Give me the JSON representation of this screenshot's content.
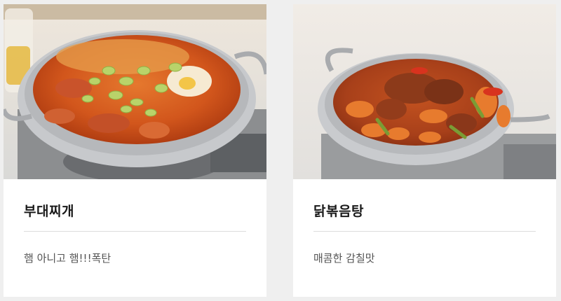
{
  "cards": [
    {
      "title": "부대찌개",
      "description": "햄 아니고 햄!!!폭탄",
      "image": "budae-jjigae-stew-photo"
    },
    {
      "title": "닭볶음탕",
      "description": "매콤한 감칠맛",
      "image": "dakbokkeumtang-braised-chicken-photo"
    }
  ]
}
